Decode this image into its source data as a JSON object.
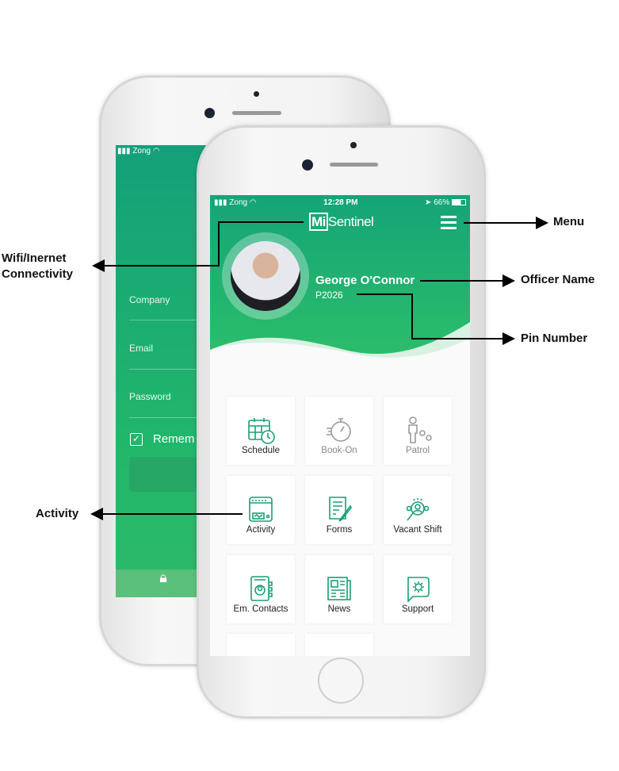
{
  "annotations": {
    "menu": "Menu",
    "officer_name": "Officer Name",
    "pin_number": "Pin Number",
    "wifi_line1": "Wifi/Inernet",
    "wifi_line2": "Connectivity",
    "activity": "Activity"
  },
  "back_phone": {
    "carrier": "Zong",
    "fields": [
      "Company",
      "Email",
      "Password"
    ],
    "remember": "Remem",
    "remember_checked": true
  },
  "front_phone": {
    "status": {
      "carrier": "Zong",
      "time": "12:28 PM",
      "battery": "66%"
    },
    "logo": {
      "mi": "Mi",
      "rest": "Sentinel"
    },
    "officer": {
      "name": "George O'Connor",
      "pin": "P2026"
    },
    "tiles": [
      {
        "label": "Schedule",
        "icon": "calendar-clock-icon",
        "enabled": true
      },
      {
        "label": "Book-On",
        "icon": "stopwatch-icon",
        "enabled": false
      },
      {
        "label": "Patrol",
        "icon": "patrol-route-icon",
        "enabled": false
      },
      {
        "label": "Activity",
        "icon": "activity-monitor-icon",
        "enabled": true
      },
      {
        "label": "Forms",
        "icon": "form-pen-icon",
        "enabled": true
      },
      {
        "label": "Vacant Shift",
        "icon": "search-person-icon",
        "enabled": true
      },
      {
        "label": "Em. Contacts",
        "icon": "contact-book-icon",
        "enabled": true
      },
      {
        "label": "News",
        "icon": "newspaper-icon",
        "enabled": true
      },
      {
        "label": "Support",
        "icon": "support-chat-gear-icon",
        "enabled": true
      }
    ]
  },
  "colors": {
    "brand_green": "#1fae73",
    "icon_green": "#1a9e78"
  }
}
